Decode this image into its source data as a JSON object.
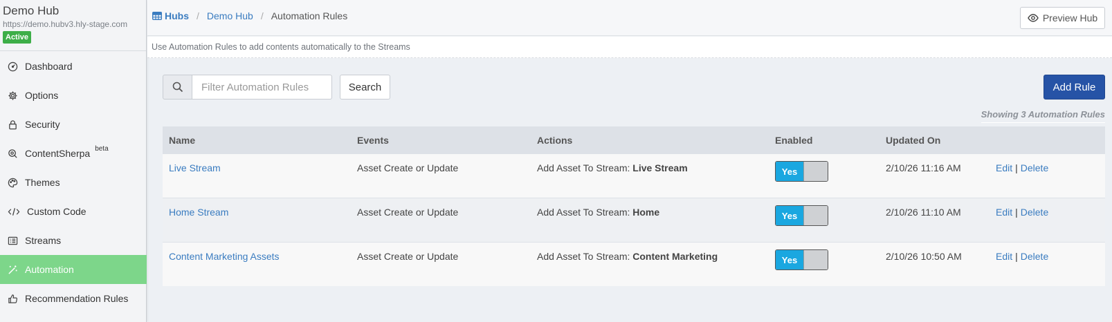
{
  "sidebar": {
    "hub_name": "Demo Hub",
    "hub_url": "https://demo.hubv3.hly-stage.com",
    "status": "Active",
    "items": [
      {
        "label": "Dashboard",
        "icon": "dashboard-icon"
      },
      {
        "label": "Options",
        "icon": "gear-icon"
      },
      {
        "label": "Security",
        "icon": "lock-icon"
      },
      {
        "label": "ContentSherpa",
        "icon": "sherpa-icon",
        "badge": "beta"
      },
      {
        "label": "Themes",
        "icon": "palette-icon"
      },
      {
        "label": "Custom Code",
        "icon": "code-icon"
      },
      {
        "label": "Streams",
        "icon": "list-icon"
      },
      {
        "label": "Automation",
        "icon": "magic-wand-icon",
        "active": true
      },
      {
        "label": "Recommendation Rules",
        "icon": "thumbs-up-icon"
      }
    ]
  },
  "breadcrumb": {
    "hubs": "Hubs",
    "hub": "Demo Hub",
    "current": "Automation Rules"
  },
  "header": {
    "preview_label": "Preview Hub",
    "description": "Use Automation Rules to add contents automatically to the Streams"
  },
  "toolbar": {
    "search_placeholder": "Filter Automation Rules",
    "search_label": "Search",
    "add_label": "Add Rule",
    "showing": "Showing 3 Automation Rules"
  },
  "table": {
    "columns": [
      "Name",
      "Events",
      "Actions",
      "Enabled",
      "Updated On"
    ],
    "rows": [
      {
        "name": "Live Stream",
        "event": "Asset Create or Update",
        "action_prefix": "Add Asset To Stream: ",
        "action_target": "Live Stream",
        "enabled": "Yes",
        "updated": "2/10/26 11:16 AM",
        "edit": "Edit",
        "delete": "Delete"
      },
      {
        "name": "Home Stream",
        "event": "Asset Create or Update",
        "action_prefix": "Add Asset To Stream: ",
        "action_target": "Home",
        "enabled": "Yes",
        "updated": "2/10/26 11:10 AM",
        "edit": "Edit",
        "delete": "Delete"
      },
      {
        "name": "Content Marketing Assets",
        "event": "Asset Create or Update",
        "action_prefix": "Add Asset To Stream: ",
        "action_target": "Content Marketing",
        "enabled": "Yes",
        "updated": "2/10/26 10:50 AM",
        "edit": "Edit",
        "delete": "Delete"
      }
    ]
  },
  "colors": {
    "accent": "#2653a6",
    "active_nav": "#7dd68a",
    "toggle_on": "#1aa7e0",
    "link": "#3a7cc0",
    "status_badge": "#3dae48"
  }
}
